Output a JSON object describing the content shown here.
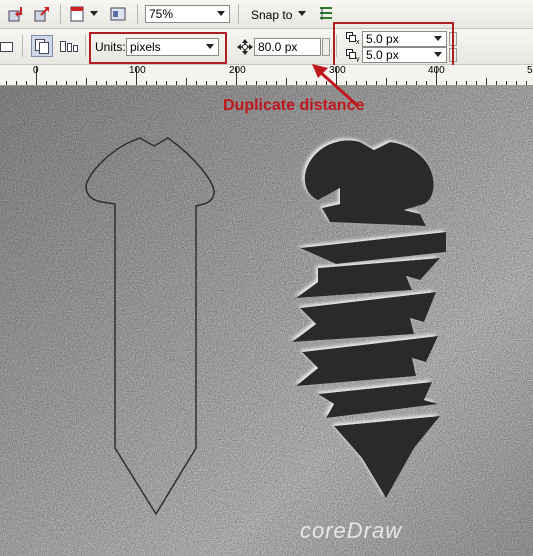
{
  "toolbar": {
    "import_icon": "import-icon",
    "export_icon": "export-icon",
    "publish_icon": "publish-pdf-icon",
    "app_launcher_icon": "application-launcher-icon",
    "zoom_value": "75%",
    "snap_label": "Snap to",
    "options_icon": "options-icon"
  },
  "property_bar": {
    "units_label": "Units:",
    "units_value": "pixels",
    "nudge_value": "80.0 px",
    "duplicate_x": "5.0 px",
    "duplicate_y": "5.0 px"
  },
  "ruler": {
    "labels": [
      "0",
      "100",
      "200",
      "300",
      "400",
      "5"
    ]
  },
  "annotation": {
    "text": "Duplicate distance"
  },
  "watermark": {
    "text": "coreDraw"
  },
  "colors": {
    "annotation_red": "#c0161e",
    "box_red": "#b01e23",
    "screw_dark": "#2b2b2b"
  }
}
